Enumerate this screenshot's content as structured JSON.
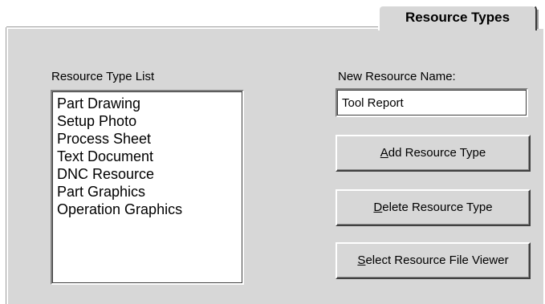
{
  "tabs": [
    {
      "label": "Resource Types",
      "selected": true
    }
  ],
  "resource_type_list": {
    "label": "Resource Type List",
    "items": [
      "Part Drawing",
      "Setup Photo",
      "Process Sheet",
      "Text Document",
      "DNC Resource",
      "Part Graphics",
      "Operation Graphics"
    ]
  },
  "new_resource": {
    "label": "New Resource Name:",
    "value": "Tool Report"
  },
  "buttons": {
    "add": {
      "mnemonic": "A",
      "rest": "dd Resource Type"
    },
    "delete": {
      "mnemonic": "D",
      "rest": "elete Resource Type"
    },
    "viewer": {
      "mnemonic": "S",
      "rest": "elect Resource File Viewer"
    }
  },
  "colors": {
    "panel_face": "#d7d7d7",
    "highlight": "#ffffff",
    "shadow": "#808080",
    "dark_shadow": "#404040"
  }
}
